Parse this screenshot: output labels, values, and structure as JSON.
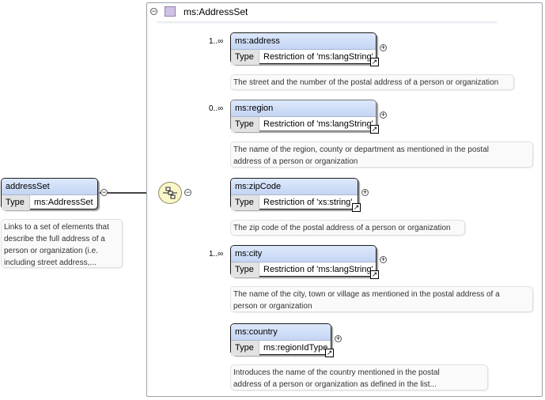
{
  "group": {
    "title": "ms:AddressSet"
  },
  "root": {
    "name": "addressSet",
    "type_label": "Type",
    "type_value": "ms:AddressSet",
    "doc_lines": [
      "Links to a set of elements that",
      "describe the full address of a",
      "person or organization (i.e.",
      "including street address,..."
    ]
  },
  "sequence": {
    "icon": "sequence-compositor-icon"
  },
  "children": [
    {
      "name": "ms:address",
      "cardinality": "1..∞",
      "type_label": "Type",
      "type_value": "Restriction of 'ms:langString'",
      "doc_lines": [
        "The street and the number of the postal address of a person or organization"
      ]
    },
    {
      "name": "ms:region",
      "cardinality": "0..∞",
      "type_label": "Type",
      "type_value": "Restriction of 'ms:langString'",
      "doc_lines": [
        "The name of the region, county or department as mentioned in the postal",
        "address of a person or organization"
      ]
    },
    {
      "name": "ms:zipCode",
      "cardinality": "",
      "type_label": "Type",
      "type_value": "Restriction of 'xs:string'",
      "doc_lines": [
        "The zip code of the postal address of a person or organization"
      ]
    },
    {
      "name": "ms:city",
      "cardinality": "1..∞",
      "type_label": "Type",
      "type_value": "Restriction of 'ms:langString'",
      "doc_lines": [
        "The name of the city, town or village as mentioned in the postal address of a",
        "person or organization"
      ]
    },
    {
      "name": "ms:country",
      "cardinality": "",
      "type_label": "Type",
      "type_value": "ms:regionIdType",
      "doc_lines": [
        "Introduces the name of the country mentioned in the postal",
        "address of a person or organization as defined in the list..."
      ]
    }
  ],
  "symbols": {
    "collapse": "−",
    "expand": "+",
    "link": "↗"
  },
  "colors": {
    "element_header": "#c4d5f3",
    "sequence_fill": "#fbf6c8",
    "group_icon": "#cfc2e6"
  }
}
